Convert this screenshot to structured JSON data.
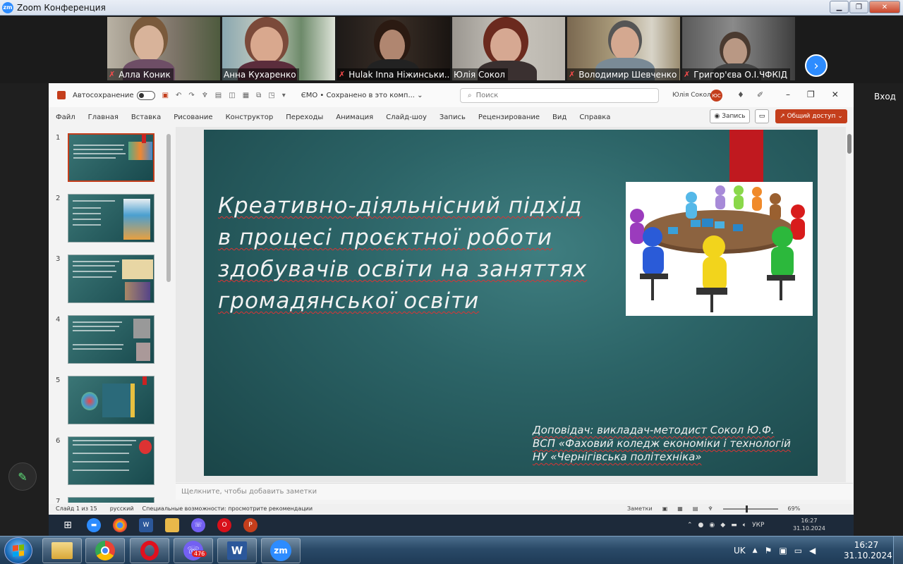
{
  "zoom_window": {
    "title": "Zoom Конференция",
    "logo": "zm"
  },
  "participants": [
    {
      "name": "Алла Коник",
      "muted": true
    },
    {
      "name": "Анна Кухаренко",
      "muted": false,
      "active": true
    },
    {
      "name": "Hulak Inna Ніжинськи...",
      "muted": true
    },
    {
      "name": "Юлія Сокол",
      "muted": false
    },
    {
      "name": "Володимир Шевченко",
      "muted": true
    },
    {
      "name": "Григор'єва О.І.ЧФКІД",
      "muted": true
    }
  ],
  "zoom_signin": "Вход",
  "ppt": {
    "autosave_label": "Автосохранение",
    "doc_name": "ЄМО • Сохранено в это комп... ⌄",
    "search_placeholder": "Поиск",
    "user_name": "Юлія Сокол",
    "user_initials": "ЮС",
    "ribbon_tabs": [
      "Файл",
      "Главная",
      "Вставка",
      "Рисование",
      "Конструктор",
      "Переходы",
      "Анимация",
      "Слайд-шоу",
      "Запись",
      "Рецензирование",
      "Вид",
      "Справка"
    ],
    "record_label": "◉ Запись",
    "comment_label": "▭",
    "share_label": "↗ Общий доступ ⌄",
    "thumbnails": [
      "1",
      "2",
      "3",
      "4",
      "5",
      "6",
      "7"
    ],
    "slide": {
      "title_lines": [
        "Креативно-діяльнісний підхід",
        "в процесі проєктної роботи",
        "здобувачів освіти на заняттях",
        "громадянської освіти"
      ],
      "footer_lines": [
        "Доповідач: викладач-методист Сокол Ю.Ф.",
        "ВСП «Фаховий коледж економіки і технологій",
        " НУ «Чернігівська політехніка»"
      ]
    },
    "notes_placeholder": "Щелкните, чтобы добавить заметки",
    "status": {
      "slide_count": "Слайд 1 из 15",
      "language": "русский",
      "accessibility": "Специальные возможности: просмотрите рекомендации",
      "notes_btn": "Заметки",
      "zoom_level": "69%"
    },
    "remote_clock": {
      "time": "16:27",
      "date": "31.10.2024"
    },
    "remote_lang": "УКР"
  },
  "taskbar": {
    "lang": "UK",
    "time": "16:27",
    "date": "31.10.2024",
    "viber_badge": "476",
    "zoom_label": "zm"
  },
  "colors": {
    "zoom_blue": "#2d8cff",
    "ppt_red": "#c43e1c",
    "slide_teal": "#2c6467",
    "active_speaker": "#c8e620"
  }
}
